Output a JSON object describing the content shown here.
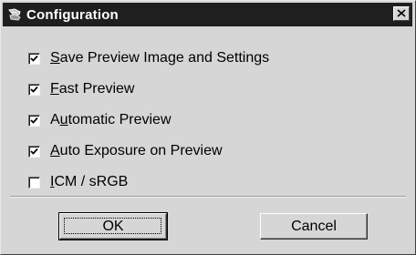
{
  "window": {
    "title": "Configuration",
    "icon": "scanner-app-icon",
    "close_icon": "close-x-icon"
  },
  "options": [
    {
      "label_mnemonic": "S",
      "label_rest": "ave Preview Image and Settings",
      "checked": true
    },
    {
      "label_mnemonic": "F",
      "label_rest": "ast Preview",
      "checked": true
    },
    {
      "label_pre": "A",
      "label_mnemonic": "u",
      "label_rest": "tomatic Preview",
      "checked": true
    },
    {
      "label_mnemonic": "A",
      "label_rest": "uto Exposure on Preview",
      "checked": true
    },
    {
      "label_mnemonic": "I",
      "label_rest": "CM / sRGB",
      "checked": false
    }
  ],
  "buttons": {
    "ok": "OK",
    "cancel": "Cancel"
  }
}
